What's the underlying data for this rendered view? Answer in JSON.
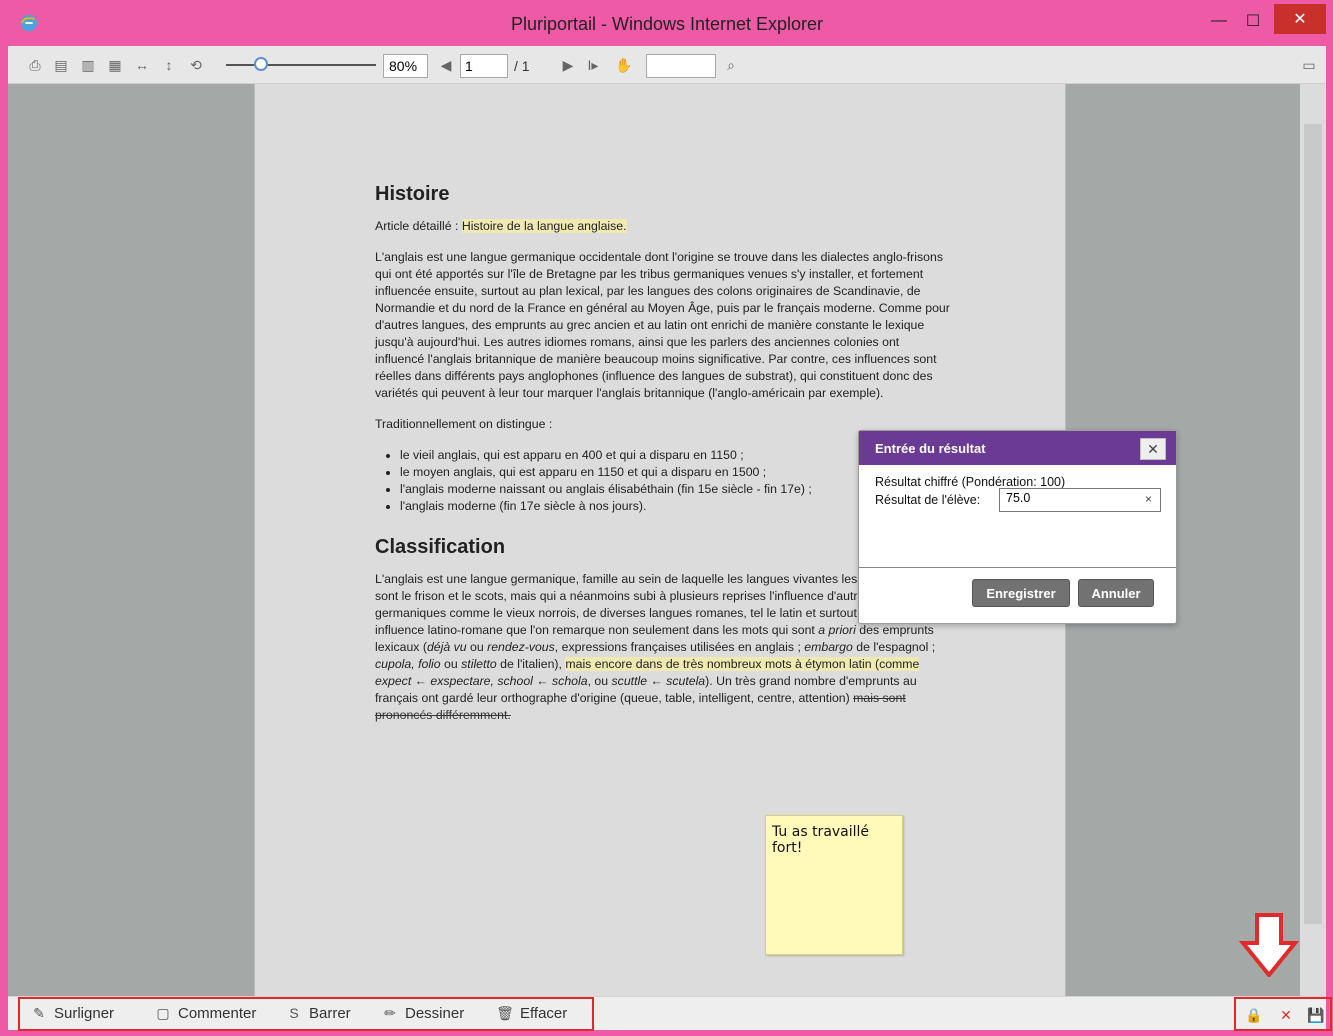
{
  "window": {
    "title": "Pluriportail - Windows Internet Explorer"
  },
  "toolbar": {
    "zoom": "80%",
    "page": "1",
    "page_total": "/ 1"
  },
  "article": {
    "h1": "Histoire",
    "intro_prefix": "Article détaillé : ",
    "intro_link": "Histoire de la langue anglaise.",
    "p1": "L'anglais est une langue germanique occidentale dont l'origine se trouve dans les dialectes anglo-frisons qui ont été apportés sur l'île de Bretagne par les tribus germaniques venues s'y installer, et fortement influencée ensuite, surtout au plan lexical, par les langues des colons originaires de Scandinavie, de Normandie et du nord de la France en général au Moyen Âge, puis par le français moderne. Comme pour d'autres langues, des emprunts au grec ancien et au latin ont enrichi de manière constante le lexique jusqu'à aujourd'hui. Les autres idiomes romans, ainsi que les parlers des anciennes colonies ont influencé l'anglais britannique de manière beaucoup moins significative. Par contre, ces influences sont réelles dans différents pays anglophones (influence des langues de substrat), qui constituent donc des variétés qui peuvent à leur tour marquer l'anglais britannique (l'anglo-américain par exemple).",
    "p2": "Traditionnellement on distingue :",
    "list": [
      "le vieil anglais, qui est apparu en 400 et qui a disparu en 1150 ;",
      "le moyen anglais, qui est apparu en 1150 et qui a disparu en 1500 ;",
      "l'anglais moderne naissant ou anglais élisabéthain (fin 15e siècle - fin 17e) ;",
      "l'anglais moderne (fin 17e siècle à nos jours)."
    ],
    "h2": "Classification",
    "p3_start": "L'anglais est une langue germanique, famille au sein de laquelle les langues vivantes les plus proches sont le frison et le scots, mais qui a néanmoins subi à plusieurs reprises l'influence d'autres langues germaniques comme le vieux norrois, de diverses langues romanes, tel le latin et surtout le français, influence latino-romane que l'on remarque non seulement dans les mots qui sont ",
    "p3_apriori": "a priori",
    "p3_mid": " des emprunts lexicaux (",
    "p3_dejavu": "déjà vu",
    "p3_ou": " ou ",
    "p3_rendezvous": "rendez-vous",
    "p3_after": ", expressions françaises utilisées en anglais ; ",
    "p3_embargo": "embargo",
    "p3_espagnol": " de l'espagnol ; ",
    "p3_cupola": "cupola, folio",
    "p3_stiletto": " ou ",
    "p3_stiletto_word": "stiletto",
    "p3_italien": " de l'italien), ",
    "p3_highlight": "mais encore dans de très nombreux mots à étymon latin (comme ",
    "p3_expect": "expect ← exspectare, school ← schola",
    "p3_ou2": ", ou ",
    "p3_scuttle": "scuttle ← scutela",
    "p3_end": "). Un très grand nombre d'emprunts au français ont gardé leur orthographe d'origine (queue, table, intelligent, centre, attention) ",
    "p3_strike": "mais sont prononcés différemment."
  },
  "dialog": {
    "title": "Entrée du résultat",
    "subtitle": "Résultat chiffré (Pondération: 100)",
    "field_label": "Résultat de l'élève:",
    "field_value": "75.0",
    "save": "Enregistrer",
    "cancel": "Annuler"
  },
  "sticky": {
    "text": "Tu as travaillé fort!"
  },
  "bottom": {
    "highlight": "Surligner",
    "comment": "Commenter",
    "strike": "Barrer",
    "draw": "Dessiner",
    "erase": "Effacer"
  },
  "colors": {
    "frame": "#ef5aa6",
    "dialog_header": "#6a3a95",
    "highlight": "#f0e9b2",
    "red_box": "#e12a2a"
  }
}
